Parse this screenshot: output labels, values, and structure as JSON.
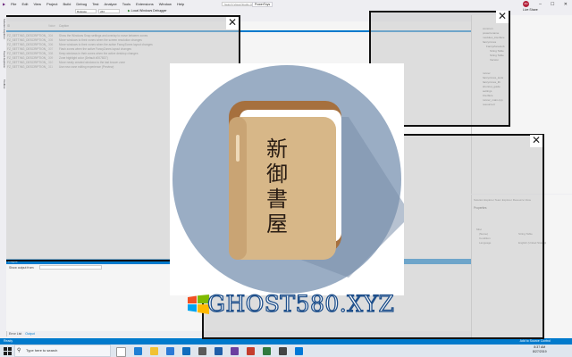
{
  "menu": [
    "File",
    "Edit",
    "View",
    "Project",
    "Build",
    "Debug",
    "Test",
    "Analyze",
    "Tools",
    "Extensions",
    "Window",
    "Help"
  ],
  "search_placeholder": "Search Visual Studio (Ctrl+Q)",
  "app_name": "PowerToys",
  "avatar_initials": "AD",
  "toolbar": {
    "config": "Release",
    "platform": "x64",
    "run_label": "Local Windows Debugger",
    "live_share": "Live Share"
  },
  "left_tabs": [
    "Solution Explorer",
    "Team Explorer",
    "Toolbox"
  ],
  "editor_rows": [
    {
      "name": "FZ_SETTING_DESCRIPTION_",
      "val": "304",
      "text": "Show the Windows Snap settings and overlay to move between zones"
    },
    {
      "name": "FZ_SETTING_DESCRIPTION_",
      "val": "305",
      "text": "Move windows to their zones when the screen resolution changes"
    },
    {
      "name": "FZ_SETTING_DESCRIPTION_",
      "val": "306",
      "text": "Move windows to their zones when the active FancyZones layout changes"
    },
    {
      "name": "FZ_SETTING_DESCRIPTION_",
      "val": "307",
      "text": "Flash zones when the active FancyZones layout changes"
    },
    {
      "name": "FZ_SETTING_DESCRIPTION_",
      "val": "308",
      "text": "Keep windows in their zones when the active desktop changes"
    },
    {
      "name": "FZ_SETTING_DESCRIPTION_",
      "val": "309",
      "text": "Zone highlight color (Default #0078D7)"
    },
    {
      "name": "FZ_SETTING_DESCRIPTION_",
      "val": "310",
      "text": "Move newly created windows to the last known zone"
    },
    {
      "name": "FZ_SETTING_DESCRIPTION_",
      "val": "311",
      "text": "Use new zone editing experience (Preview)"
    }
  ],
  "editor_header": {
    "c1": "ID",
    "c2": "Value",
    "c3": "Caption"
  },
  "solution_items": [
    "common",
    "powerrename",
    "modules_interface",
    "fancyzones",
    "FancyZonesLib",
    "String Table",
    "String Table",
    "Version",
    "runner",
    "fancyzones_tests",
    "fancyzones_lib",
    "shortcut_guide",
    "settings",
    "interface",
    "runner_main.cpp",
    "resource.h"
  ],
  "properties_tabs": "Solution Explorer  Team Explorer  Resource View",
  "properties_title": "Properties",
  "properties_rows": [
    "Misc",
    "(Name)",
    "Condition",
    "Language"
  ],
  "properties_values": [
    "String Table",
    "",
    "English (United States)"
  ],
  "output": {
    "title": "Output",
    "show_label": "Show output from:"
  },
  "bottom_tabs": [
    "Error List",
    "Output"
  ],
  "status": {
    "ready": "Ready",
    "source_control": "Add to Source Control"
  },
  "taskbar": {
    "search": "Type here to search",
    "time": "8:37 AM",
    "date": "8/27/2019"
  },
  "watermark": "GHOST580.XYZ",
  "logo_chars": [
    "新",
    "御",
    "書",
    "屋"
  ],
  "close_glyph": "✕",
  "colors": {
    "accent": "#007acc",
    "logo_circle": "#9aadc4",
    "book_cover": "#d7b788",
    "book_spine": "#a6703e",
    "watermark_stroke": "#1e4f8b"
  }
}
